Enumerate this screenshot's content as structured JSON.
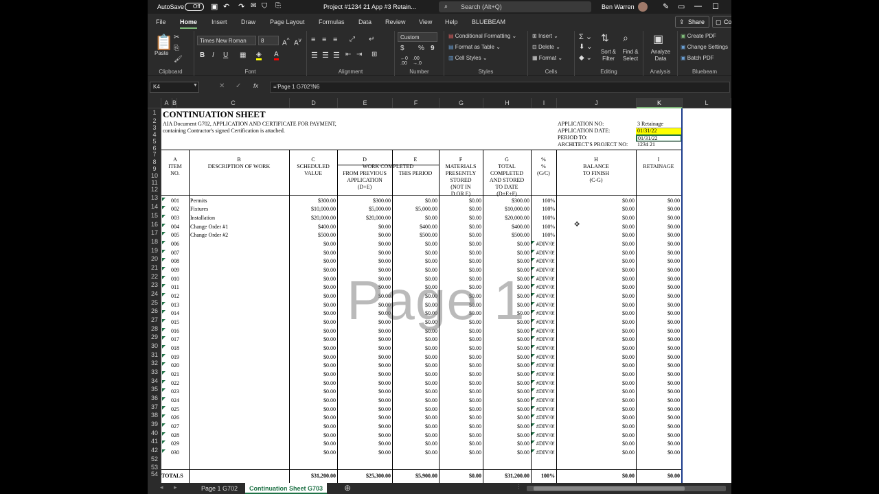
{
  "titlebar": {
    "autosave": "AutoSave",
    "toggle": "Off",
    "doc_title": "Project #1234 21 App #3 Retain...",
    "search": "Search (Alt+Q)",
    "user": "Ben Warren"
  },
  "ribbon_tabs": [
    "File",
    "Home",
    "Insert",
    "Draw",
    "Page Layout",
    "Formulas",
    "Data",
    "Review",
    "View",
    "Help",
    "BLUEBEAM"
  ],
  "share": "Share",
  "co": "Co",
  "ribbon": {
    "paste": "Paste",
    "clipboard": "Clipboard",
    "font_name": "Times New Roman",
    "font_size": "8",
    "font": "Font",
    "alignment": "Alignment",
    "number_format": "Custom",
    "number": "Number",
    "cond_fmt": "Conditional Formatting",
    "format_table": "Format as Table",
    "cell_styles": "Cell Styles",
    "styles": "Styles",
    "insert": "Insert",
    "delete": "Delete",
    "format": "Format",
    "cells": "Cells",
    "sort": "Sort & Filter",
    "find": "Find & Select",
    "editing": "Editing",
    "analyze": "Analyze Data",
    "analysis": "Analysis",
    "create_pdf": "Create PDF",
    "change_settings": "Change Settings",
    "batch_pdf": "Batch PDF",
    "bluebeam": "Bluebeam"
  },
  "formula_bar": {
    "name_box": "K4",
    "formula": "='Page 1 G702'!N6"
  },
  "columns": [
    "A",
    "B",
    "C",
    "D",
    "E",
    "F",
    "G",
    "H",
    "I",
    "J",
    "K",
    "L"
  ],
  "rows": [
    "1",
    "2",
    "3",
    "4",
    "5",
    "6",
    "7",
    "8",
    "9",
    "10",
    "11",
    "12",
    "13",
    "14",
    "15",
    "16",
    "17",
    "18",
    "19",
    "20",
    "21",
    "22",
    "23",
    "24",
    "25",
    "26",
    "27",
    "28",
    "29",
    "30",
    "31",
    "32",
    "33",
    "34",
    "35",
    "36",
    "37",
    "38",
    "39",
    "40",
    "41",
    "42",
    "52",
    "53",
    "54"
  ],
  "sheet": {
    "title": "CONTINUATION SHEET",
    "doc_line1": "AIA Document G702, APPLICATION AND CERTIFICATE FOR PAYMENT,",
    "doc_line2": "containing Contractor's signed Certification is attached.",
    "app_no_label": "APPLICATION NO:",
    "app_no": "3 Retainage",
    "app_date_label": "APPLICATION DATE:",
    "app_date": "01/31/22",
    "period_label": "PERIOD TO:",
    "period": "01/31/22",
    "arch_label": "ARCHITECT'S PROJECT NO:",
    "arch": "1234 21",
    "letters": [
      "A",
      "B",
      "C",
      "D",
      "E",
      "F",
      "G",
      "%",
      "H",
      "I"
    ],
    "h_item": "ITEM",
    "h_no": "NO.",
    "h_desc": "DESCRIPTION OF WORK",
    "h_sched1": "SCHEDULED",
    "h_sched2": "VALUE",
    "h_work": "WORK COMPLETED",
    "h_prev1": "FROM PREVIOUS",
    "h_prev2": "APPLICATION",
    "h_prev3": "(D+E)",
    "h_this": "THIS PERIOD",
    "h_mat1": "MATERIALS",
    "h_mat2": "PRESENTLY",
    "h_mat3": "STORED",
    "h_mat4": "(NOT IN",
    "h_mat5": "D OR E)",
    "h_tot1": "TOTAL",
    "h_tot2": "COMPLETED",
    "h_tot3": "AND STORED",
    "h_tot4": "TO DATE",
    "h_tot5": "(D+E+F)",
    "h_pct1": "%",
    "h_pct2": "(G/C)",
    "h_bal1": "BALANCE",
    "h_bal2": "TO FINISH",
    "h_bal3": "(C-G)",
    "h_ret": "RETAINAGE",
    "watermark": "Page 1",
    "totals": {
      "label": "TOTALS",
      "c": "$31,200.00",
      "d": "$25,300.00",
      "e": "$5,900.00",
      "f": "$0.00",
      "g": "$31,200.00",
      "pct": "100%",
      "h": "$0.00",
      "i": "$0.00"
    }
  },
  "items": [
    {
      "no": "001",
      "desc": "Permits",
      "c": "$300.00",
      "d": "$300.00",
      "e": "$0.00",
      "f": "$0.00",
      "g": "$300.00",
      "pct": "100%",
      "h": "$0.00",
      "i": "$0.00"
    },
    {
      "no": "002",
      "desc": "Fixtures",
      "c": "$10,000.00",
      "d": "$5,000.00",
      "e": "$5,000.00",
      "f": "$0.00",
      "g": "$10,000.00",
      "pct": "100%",
      "h": "$0.00",
      "i": "$0.00"
    },
    {
      "no": "003",
      "desc": "Installation",
      "c": "$20,000.00",
      "d": "$20,000.00",
      "e": "$0.00",
      "f": "$0.00",
      "g": "$20,000.00",
      "pct": "100%",
      "h": "$0.00",
      "i": "$0.00"
    },
    {
      "no": "004",
      "desc": "Change Order #1",
      "c": "$400.00",
      "d": "$0.00",
      "e": "$400.00",
      "f": "$0.00",
      "g": "$400.00",
      "pct": "100%",
      "h": "$0.00",
      "i": "$0.00"
    },
    {
      "no": "005",
      "desc": "Change Order #2",
      "c": "$500.00",
      "d": "$0.00",
      "e": "$500.00",
      "f": "$0.00",
      "g": "$500.00",
      "pct": "100%",
      "h": "$0.00",
      "i": "$0.00"
    },
    {
      "no": "006",
      "desc": "",
      "c": "$0.00",
      "d": "$0.00",
      "e": "$0.00",
      "f": "$0.00",
      "g": "$0.00",
      "pct": "#DIV/0!",
      "h": "$0.00",
      "i": "$0.00"
    },
    {
      "no": "007",
      "desc": "",
      "c": "$0.00",
      "d": "$0.00",
      "e": "$0.00",
      "f": "$0.00",
      "g": "$0.00",
      "pct": "#DIV/0!",
      "h": "$0.00",
      "i": "$0.00"
    },
    {
      "no": "008",
      "desc": "",
      "c": "$0.00",
      "d": "$0.00",
      "e": "$0.00",
      "f": "$0.00",
      "g": "$0.00",
      "pct": "#DIV/0!",
      "h": "$0.00",
      "i": "$0.00"
    },
    {
      "no": "009",
      "desc": "",
      "c": "$0.00",
      "d": "$0.00",
      "e": "$0.00",
      "f": "$0.00",
      "g": "$0.00",
      "pct": "#DIV/0!",
      "h": "$0.00",
      "i": "$0.00"
    },
    {
      "no": "010",
      "desc": "",
      "c": "$0.00",
      "d": "$0.00",
      "e": "$0.00",
      "f": "$0.00",
      "g": "$0.00",
      "pct": "#DIV/0!",
      "h": "$0.00",
      "i": "$0.00"
    },
    {
      "no": "011",
      "desc": "",
      "c": "$0.00",
      "d": "$0.00",
      "e": "$0.00",
      "f": "$0.00",
      "g": "$0.00",
      "pct": "#DIV/0!",
      "h": "$0.00",
      "i": "$0.00"
    },
    {
      "no": "012",
      "desc": "",
      "c": "$0.00",
      "d": "$0.00",
      "e": "$0.00",
      "f": "$0.00",
      "g": "$0.00",
      "pct": "#DIV/0!",
      "h": "$0.00",
      "i": "$0.00"
    },
    {
      "no": "013",
      "desc": "",
      "c": "$0.00",
      "d": "$0.00",
      "e": "$0.00",
      "f": "$0.00",
      "g": "$0.00",
      "pct": "#DIV/0!",
      "h": "$0.00",
      "i": "$0.00"
    },
    {
      "no": "014",
      "desc": "",
      "c": "$0.00",
      "d": "$0.00",
      "e": "$0.00",
      "f": "$0.00",
      "g": "$0.00",
      "pct": "#DIV/0!",
      "h": "$0.00",
      "i": "$0.00"
    },
    {
      "no": "015",
      "desc": "",
      "c": "$0.00",
      "d": "$0.00",
      "e": "$0.00",
      "f": "$0.00",
      "g": "$0.00",
      "pct": "#DIV/0!",
      "h": "$0.00",
      "i": "$0.00"
    },
    {
      "no": "016",
      "desc": "",
      "c": "$0.00",
      "d": "$0.00",
      "e": "$0.00",
      "f": "$0.00",
      "g": "$0.00",
      "pct": "#DIV/0!",
      "h": "$0.00",
      "i": "$0.00"
    },
    {
      "no": "017",
      "desc": "",
      "c": "$0.00",
      "d": "$0.00",
      "e": "$0.00",
      "f": "$0.00",
      "g": "$0.00",
      "pct": "#DIV/0!",
      "h": "$0.00",
      "i": "$0.00"
    },
    {
      "no": "018",
      "desc": "",
      "c": "$0.00",
      "d": "$0.00",
      "e": "$0.00",
      "f": "$0.00",
      "g": "$0.00",
      "pct": "#DIV/0!",
      "h": "$0.00",
      "i": "$0.00"
    },
    {
      "no": "019",
      "desc": "",
      "c": "$0.00",
      "d": "$0.00",
      "e": "$0.00",
      "f": "$0.00",
      "g": "$0.00",
      "pct": "#DIV/0!",
      "h": "$0.00",
      "i": "$0.00"
    },
    {
      "no": "020",
      "desc": "",
      "c": "$0.00",
      "d": "$0.00",
      "e": "$0.00",
      "f": "$0.00",
      "g": "$0.00",
      "pct": "#DIV/0!",
      "h": "$0.00",
      "i": "$0.00"
    },
    {
      "no": "021",
      "desc": "",
      "c": "$0.00",
      "d": "$0.00",
      "e": "$0.00",
      "f": "$0.00",
      "g": "$0.00",
      "pct": "#DIV/0!",
      "h": "$0.00",
      "i": "$0.00"
    },
    {
      "no": "022",
      "desc": "",
      "c": "$0.00",
      "d": "$0.00",
      "e": "$0.00",
      "f": "$0.00",
      "g": "$0.00",
      "pct": "#DIV/0!",
      "h": "$0.00",
      "i": "$0.00"
    },
    {
      "no": "023",
      "desc": "",
      "c": "$0.00",
      "d": "$0.00",
      "e": "$0.00",
      "f": "$0.00",
      "g": "$0.00",
      "pct": "#DIV/0!",
      "h": "$0.00",
      "i": "$0.00"
    },
    {
      "no": "024",
      "desc": "",
      "c": "$0.00",
      "d": "$0.00",
      "e": "$0.00",
      "f": "$0.00",
      "g": "$0.00",
      "pct": "#DIV/0!",
      "h": "$0.00",
      "i": "$0.00"
    },
    {
      "no": "025",
      "desc": "",
      "c": "$0.00",
      "d": "$0.00",
      "e": "$0.00",
      "f": "$0.00",
      "g": "$0.00",
      "pct": "#DIV/0!",
      "h": "$0.00",
      "i": "$0.00"
    },
    {
      "no": "026",
      "desc": "",
      "c": "$0.00",
      "d": "$0.00",
      "e": "$0.00",
      "f": "$0.00",
      "g": "$0.00",
      "pct": "#DIV/0!",
      "h": "$0.00",
      "i": "$0.00"
    },
    {
      "no": "027",
      "desc": "",
      "c": "$0.00",
      "d": "$0.00",
      "e": "$0.00",
      "f": "$0.00",
      "g": "$0.00",
      "pct": "#DIV/0!",
      "h": "$0.00",
      "i": "$0.00"
    },
    {
      "no": "028",
      "desc": "",
      "c": "$0.00",
      "d": "$0.00",
      "e": "$0.00",
      "f": "$0.00",
      "g": "$0.00",
      "pct": "#DIV/0!",
      "h": "$0.00",
      "i": "$0.00"
    },
    {
      "no": "029",
      "desc": "",
      "c": "$0.00",
      "d": "$0.00",
      "e": "$0.00",
      "f": "$0.00",
      "g": "$0.00",
      "pct": "#DIV/0!",
      "h": "$0.00",
      "i": "$0.00"
    },
    {
      "no": "030",
      "desc": "",
      "c": "$0.00",
      "d": "$0.00",
      "e": "$0.00",
      "f": "$0.00",
      "g": "$0.00",
      "pct": "#DIV/0!",
      "h": "$0.00",
      "i": "$0.00"
    }
  ],
  "sheet_tabs": {
    "tab1": "Page 1 G702",
    "tab2": "Continuation Sheet G703"
  },
  "colors": {
    "accent": "#1e7145",
    "highlight": "#ffff00"
  }
}
